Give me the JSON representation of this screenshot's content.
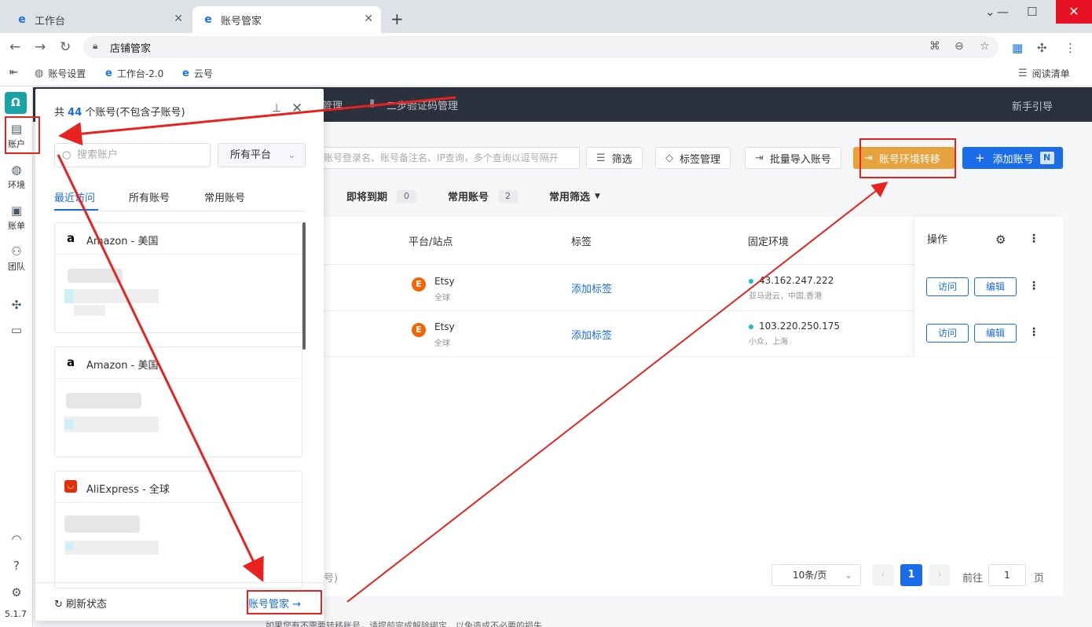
{
  "browser": {
    "tabs": [
      {
        "label": "工作台"
      },
      {
        "label": "账号管家"
      }
    ],
    "address": "店铺管家",
    "bookmarks": [
      "账号设置",
      "工作台-2.0",
      "云号"
    ],
    "reading_list": "阅读清单"
  },
  "sidebar": {
    "items": [
      {
        "label": "账户"
      },
      {
        "label": "环境"
      },
      {
        "label": "账单"
      },
      {
        "label": "团队"
      }
    ],
    "version": "5.1.7"
  },
  "topbar": {
    "link1": "管理",
    "link2": "二步验证码管理",
    "guide": "新手引导"
  },
  "toolbar": {
    "search_placeholder": "账号登录名、账号备注名、IP查询，多个查询以逗号隔开",
    "filter": "筛选",
    "tag_manage": "标签管理",
    "batch_import": "批量导入账号",
    "env_transfer": "账号环境转移",
    "add_account": "添加账号",
    "add_badge": "N"
  },
  "filters": [
    {
      "label": "即将到期",
      "count": "0"
    },
    {
      "label": "常用账号",
      "count": "2"
    },
    {
      "label": "常用筛选"
    }
  ],
  "table": {
    "headers": {
      "platform": "平台/站点",
      "tag": "标签",
      "env": "固定环境",
      "ops": "操作"
    },
    "rows": [
      {
        "platform": "Etsy",
        "site": "全球",
        "tag": "添加标签",
        "ip": "43.162.247.222",
        "loc": "亚马逊云，中国,香港",
        "visit": "访问",
        "edit": "编辑"
      },
      {
        "platform": "Etsy",
        "site": "全球",
        "tag": "添加标签",
        "ip": "103.220.250.175",
        "loc": "小众，上海",
        "visit": "访问",
        "edit": "编辑"
      }
    ],
    "total_partial": "号)"
  },
  "pager": {
    "size": "10条/页",
    "current": "1",
    "goto": "前往",
    "goto_value": "1",
    "page_unit": "页"
  },
  "panel": {
    "title_prefix": "共",
    "count": "44",
    "title_suffix": "个账号(不包含子账号)",
    "search_placeholder": "搜索账户",
    "platform_select": "所有平台",
    "tabs": [
      "最近访问",
      "所有账号",
      "常用账号"
    ],
    "cards": [
      {
        "name": "Amazon - 美国"
      },
      {
        "name": "Amazon - 美国"
      },
      {
        "name": "AliExpress - 全球"
      }
    ],
    "refresh": "刷新状态",
    "manage": "账号管家"
  },
  "footnote": "如果您有不需要转移账号，请提前完成解除绑定，以免造成不必要的损失",
  "colors": {
    "accent": "#1a6ce8",
    "warning": "#e6a23c",
    "annotation": "#e8231f"
  }
}
